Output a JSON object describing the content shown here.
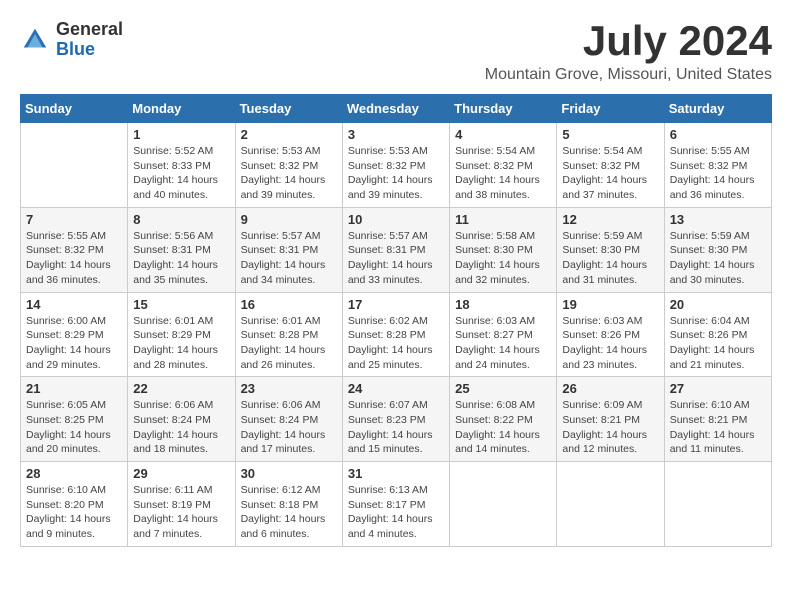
{
  "logo": {
    "general": "General",
    "blue": "Blue"
  },
  "title": "July 2024",
  "subtitle": "Mountain Grove, Missouri, United States",
  "header_color": "#2c6fad",
  "days_of_week": [
    "Sunday",
    "Monday",
    "Tuesday",
    "Wednesday",
    "Thursday",
    "Friday",
    "Saturday"
  ],
  "weeks": [
    [
      {
        "day": "",
        "sunrise": "",
        "sunset": "",
        "daylight": ""
      },
      {
        "day": "1",
        "sunrise": "Sunrise: 5:52 AM",
        "sunset": "Sunset: 8:33 PM",
        "daylight": "Daylight: 14 hours and 40 minutes."
      },
      {
        "day": "2",
        "sunrise": "Sunrise: 5:53 AM",
        "sunset": "Sunset: 8:32 PM",
        "daylight": "Daylight: 14 hours and 39 minutes."
      },
      {
        "day": "3",
        "sunrise": "Sunrise: 5:53 AM",
        "sunset": "Sunset: 8:32 PM",
        "daylight": "Daylight: 14 hours and 39 minutes."
      },
      {
        "day": "4",
        "sunrise": "Sunrise: 5:54 AM",
        "sunset": "Sunset: 8:32 PM",
        "daylight": "Daylight: 14 hours and 38 minutes."
      },
      {
        "day": "5",
        "sunrise": "Sunrise: 5:54 AM",
        "sunset": "Sunset: 8:32 PM",
        "daylight": "Daylight: 14 hours and 37 minutes."
      },
      {
        "day": "6",
        "sunrise": "Sunrise: 5:55 AM",
        "sunset": "Sunset: 8:32 PM",
        "daylight": "Daylight: 14 hours and 36 minutes."
      }
    ],
    [
      {
        "day": "7",
        "sunrise": "Sunrise: 5:55 AM",
        "sunset": "Sunset: 8:32 PM",
        "daylight": "Daylight: 14 hours and 36 minutes."
      },
      {
        "day": "8",
        "sunrise": "Sunrise: 5:56 AM",
        "sunset": "Sunset: 8:31 PM",
        "daylight": "Daylight: 14 hours and 35 minutes."
      },
      {
        "day": "9",
        "sunrise": "Sunrise: 5:57 AM",
        "sunset": "Sunset: 8:31 PM",
        "daylight": "Daylight: 14 hours and 34 minutes."
      },
      {
        "day": "10",
        "sunrise": "Sunrise: 5:57 AM",
        "sunset": "Sunset: 8:31 PM",
        "daylight": "Daylight: 14 hours and 33 minutes."
      },
      {
        "day": "11",
        "sunrise": "Sunrise: 5:58 AM",
        "sunset": "Sunset: 8:30 PM",
        "daylight": "Daylight: 14 hours and 32 minutes."
      },
      {
        "day": "12",
        "sunrise": "Sunrise: 5:59 AM",
        "sunset": "Sunset: 8:30 PM",
        "daylight": "Daylight: 14 hours and 31 minutes."
      },
      {
        "day": "13",
        "sunrise": "Sunrise: 5:59 AM",
        "sunset": "Sunset: 8:30 PM",
        "daylight": "Daylight: 14 hours and 30 minutes."
      }
    ],
    [
      {
        "day": "14",
        "sunrise": "Sunrise: 6:00 AM",
        "sunset": "Sunset: 8:29 PM",
        "daylight": "Daylight: 14 hours and 29 minutes."
      },
      {
        "day": "15",
        "sunrise": "Sunrise: 6:01 AM",
        "sunset": "Sunset: 8:29 PM",
        "daylight": "Daylight: 14 hours and 28 minutes."
      },
      {
        "day": "16",
        "sunrise": "Sunrise: 6:01 AM",
        "sunset": "Sunset: 8:28 PM",
        "daylight": "Daylight: 14 hours and 26 minutes."
      },
      {
        "day": "17",
        "sunrise": "Sunrise: 6:02 AM",
        "sunset": "Sunset: 8:28 PM",
        "daylight": "Daylight: 14 hours and 25 minutes."
      },
      {
        "day": "18",
        "sunrise": "Sunrise: 6:03 AM",
        "sunset": "Sunset: 8:27 PM",
        "daylight": "Daylight: 14 hours and 24 minutes."
      },
      {
        "day": "19",
        "sunrise": "Sunrise: 6:03 AM",
        "sunset": "Sunset: 8:26 PM",
        "daylight": "Daylight: 14 hours and 23 minutes."
      },
      {
        "day": "20",
        "sunrise": "Sunrise: 6:04 AM",
        "sunset": "Sunset: 8:26 PM",
        "daylight": "Daylight: 14 hours and 21 minutes."
      }
    ],
    [
      {
        "day": "21",
        "sunrise": "Sunrise: 6:05 AM",
        "sunset": "Sunset: 8:25 PM",
        "daylight": "Daylight: 14 hours and 20 minutes."
      },
      {
        "day": "22",
        "sunrise": "Sunrise: 6:06 AM",
        "sunset": "Sunset: 8:24 PM",
        "daylight": "Daylight: 14 hours and 18 minutes."
      },
      {
        "day": "23",
        "sunrise": "Sunrise: 6:06 AM",
        "sunset": "Sunset: 8:24 PM",
        "daylight": "Daylight: 14 hours and 17 minutes."
      },
      {
        "day": "24",
        "sunrise": "Sunrise: 6:07 AM",
        "sunset": "Sunset: 8:23 PM",
        "daylight": "Daylight: 14 hours and 15 minutes."
      },
      {
        "day": "25",
        "sunrise": "Sunrise: 6:08 AM",
        "sunset": "Sunset: 8:22 PM",
        "daylight": "Daylight: 14 hours and 14 minutes."
      },
      {
        "day": "26",
        "sunrise": "Sunrise: 6:09 AM",
        "sunset": "Sunset: 8:21 PM",
        "daylight": "Daylight: 14 hours and 12 minutes."
      },
      {
        "day": "27",
        "sunrise": "Sunrise: 6:10 AM",
        "sunset": "Sunset: 8:21 PM",
        "daylight": "Daylight: 14 hours and 11 minutes."
      }
    ],
    [
      {
        "day": "28",
        "sunrise": "Sunrise: 6:10 AM",
        "sunset": "Sunset: 8:20 PM",
        "daylight": "Daylight: 14 hours and 9 minutes."
      },
      {
        "day": "29",
        "sunrise": "Sunrise: 6:11 AM",
        "sunset": "Sunset: 8:19 PM",
        "daylight": "Daylight: 14 hours and 7 minutes."
      },
      {
        "day": "30",
        "sunrise": "Sunrise: 6:12 AM",
        "sunset": "Sunset: 8:18 PM",
        "daylight": "Daylight: 14 hours and 6 minutes."
      },
      {
        "day": "31",
        "sunrise": "Sunrise: 6:13 AM",
        "sunset": "Sunset: 8:17 PM",
        "daylight": "Daylight: 14 hours and 4 minutes."
      },
      {
        "day": "",
        "sunrise": "",
        "sunset": "",
        "daylight": ""
      },
      {
        "day": "",
        "sunrise": "",
        "sunset": "",
        "daylight": ""
      },
      {
        "day": "",
        "sunrise": "",
        "sunset": "",
        "daylight": ""
      }
    ]
  ]
}
